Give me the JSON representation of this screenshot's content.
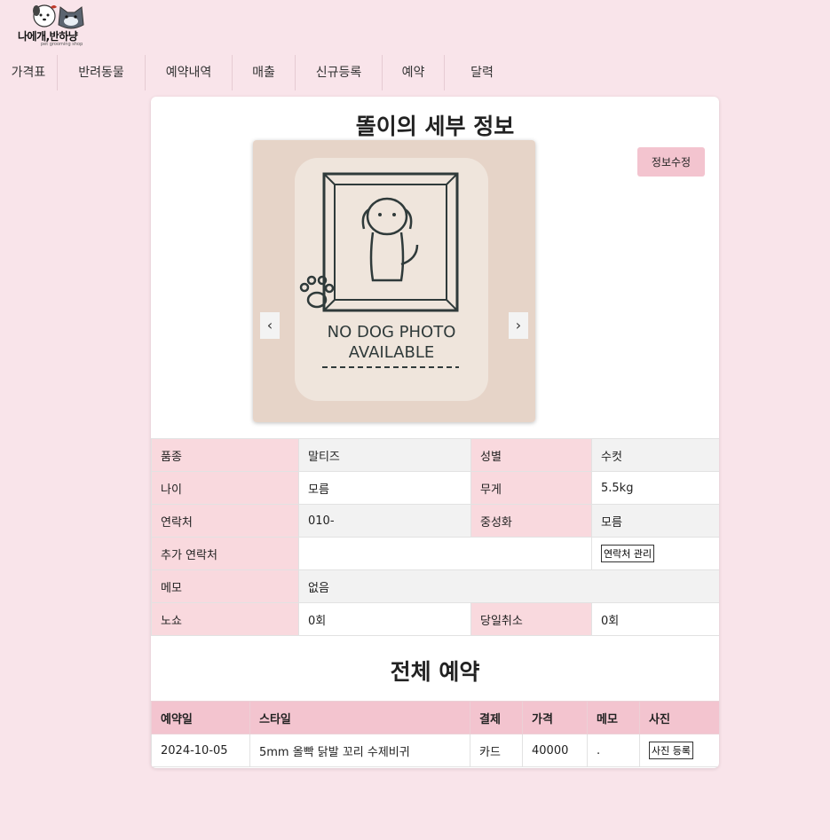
{
  "brand": {
    "name": "나에개,반하냥",
    "tagline": "pet grooming shop"
  },
  "nav": [
    {
      "label": "가격표"
    },
    {
      "label": "반려동물"
    },
    {
      "label": "예약내역"
    },
    {
      "label": "매출"
    },
    {
      "label": "신규등록"
    },
    {
      "label": "예약"
    },
    {
      "label": "달력"
    }
  ],
  "detail": {
    "title": "똘이의 세부 정보",
    "edit_button": "정보수정",
    "photo": {
      "line1": "NO DOG PHOTO",
      "line2": "AVAILABLE",
      "prev": "‹",
      "next": "›"
    },
    "info": {
      "breed_label": "품종",
      "breed": "말티즈",
      "sex_label": "성별",
      "sex": "수컷",
      "age_label": "나이",
      "age": "모름",
      "weight_label": "무게",
      "weight": "5.5kg",
      "contact_label": "연락처",
      "contact": "010-",
      "neutered_label": "중성화",
      "neutered": "모름",
      "extra_contact_label": "추가 연락처",
      "extra_contact": "",
      "contact_manage_button": "연락처 관리",
      "memo_label": "메모",
      "memo": "없음",
      "noshow_label": "노쇼",
      "noshow": "0회",
      "same_day_cancel_label": "당일취소",
      "same_day_cancel": "0회"
    }
  },
  "reservations": {
    "title": "전체 예약",
    "headers": [
      "예약일",
      "스타일",
      "결제",
      "가격",
      "메모",
      "사진"
    ],
    "rows": [
      {
        "date": "2024-10-05",
        "style": "5mm 올빡 닭발 꼬리 수제비귀",
        "payment": "카드",
        "price": "40000",
        "memo": ".",
        "photo_button": "사진 등록"
      }
    ]
  },
  "colors": {
    "background": "#f9e4ea",
    "accent": "#f3c4cf",
    "label_cell": "#f9d9de"
  }
}
